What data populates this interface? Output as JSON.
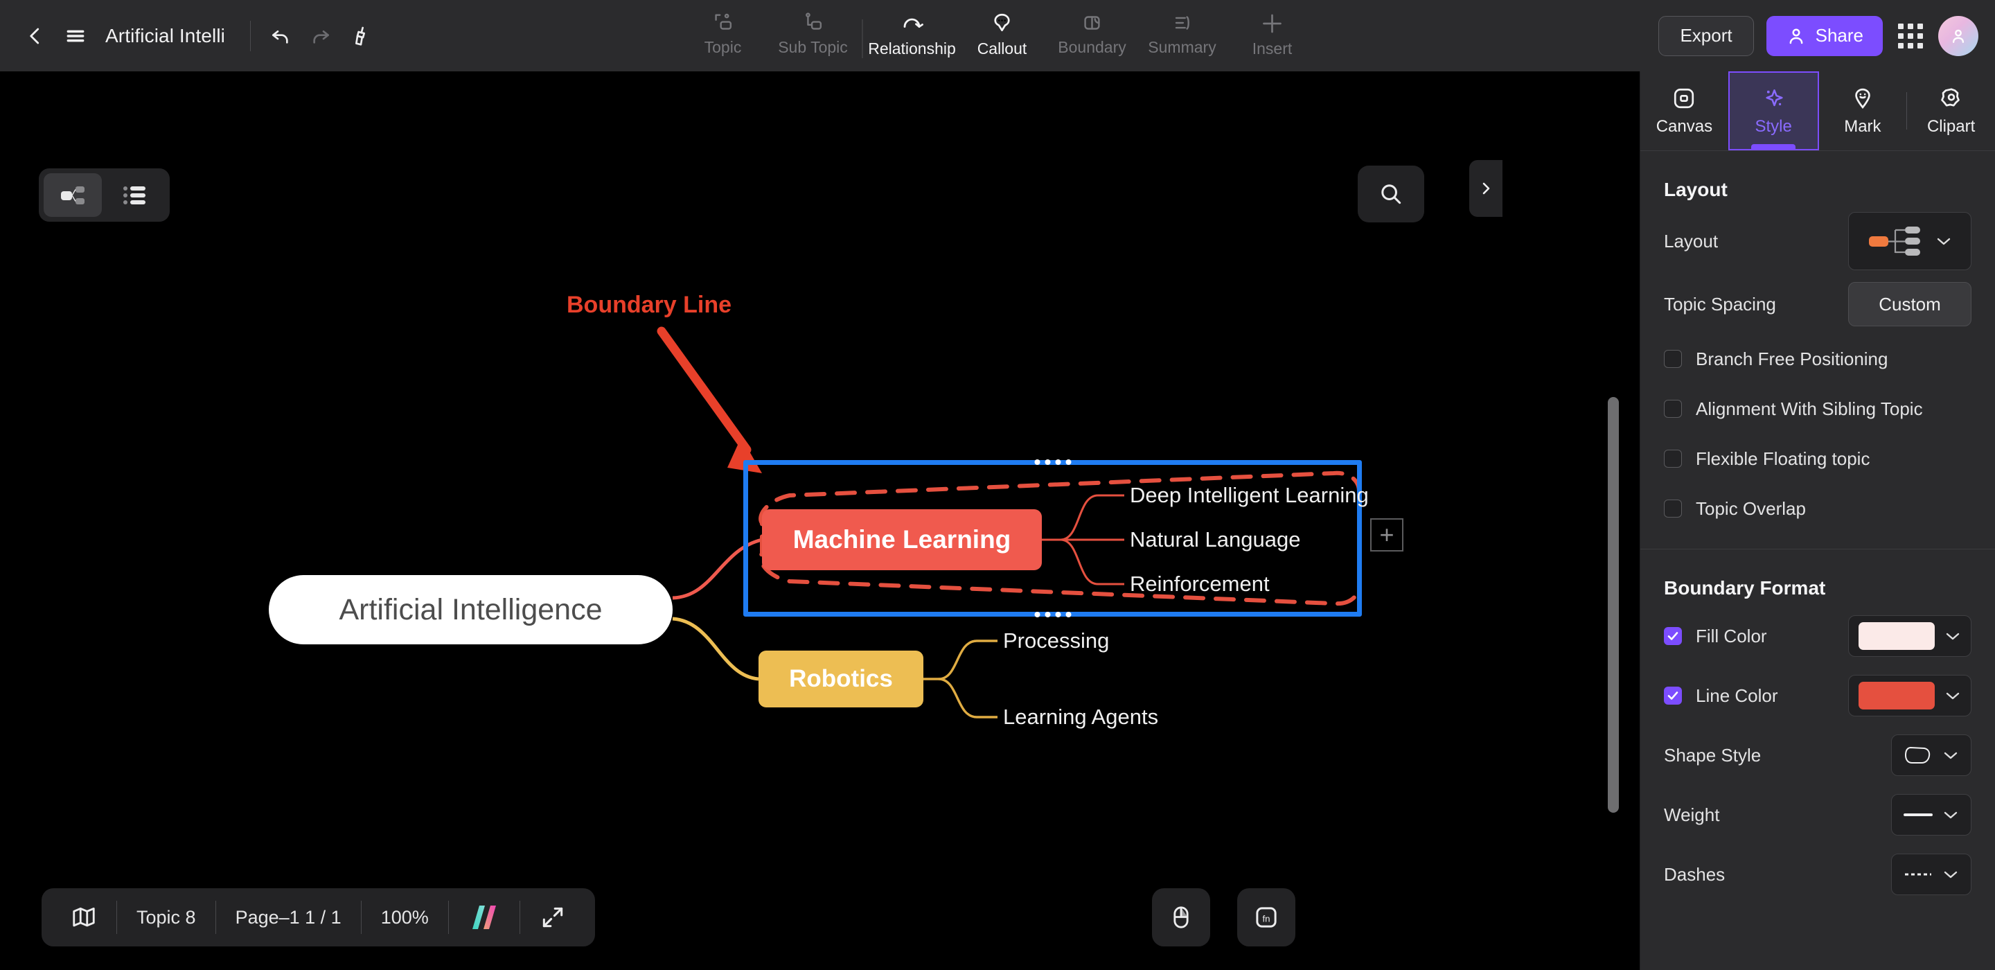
{
  "header": {
    "back_icon": "chevron-left-icon",
    "menu_icon": "hamburger-menu-icon",
    "doc_title": "Artificial Intelli",
    "undo_icon": "undo-icon",
    "redo_icon": "redo-icon",
    "format_painter_icon": "format-painter-icon",
    "tools": [
      {
        "label": "Topic",
        "icon": "topic-icon",
        "enabled": false
      },
      {
        "label": "Sub Topic",
        "icon": "sub-topic-icon",
        "enabled": false
      },
      {
        "label": "Relationship",
        "icon": "relationship-icon",
        "enabled": true
      },
      {
        "label": "Callout",
        "icon": "callout-icon",
        "enabled": true
      },
      {
        "label": "Boundary",
        "icon": "boundary-icon",
        "enabled": false
      },
      {
        "label": "Summary",
        "icon": "summary-icon",
        "enabled": false
      },
      {
        "label": "Insert",
        "icon": "insert-plus-icon",
        "enabled": false
      }
    ],
    "export_label": "Export",
    "share_label": "Share",
    "share_icon": "person-share-icon",
    "apps_icon": "apps-grid-icon",
    "avatar_icon": "user-avatar"
  },
  "canvas": {
    "view_toggle": {
      "mindmap_icon": "mindmap-view-icon",
      "outline_icon": "outline-view-icon",
      "selected": "mindmap"
    },
    "search_icon": "search-icon",
    "collapse_icon": "chevron-right-icon",
    "add_button_label": "+",
    "annotation": {
      "label": "Boundary Line",
      "color": "#e8402a",
      "arrow_icon": "annotation-arrow-icon"
    },
    "nodes": {
      "root": {
        "label": "Artificial Intelligence",
        "fill": "#ffffff",
        "text_color": "#4d4d4d"
      },
      "machine_learning": {
        "label": "Machine Learning",
        "fill": "#f05a4e",
        "text_color": "#ffffff",
        "children": [
          "Deep Intelligent Learning",
          "Natural Language",
          "Reinforcement"
        ]
      },
      "robotics": {
        "label": "Robotics",
        "fill": "#edbe53",
        "text_color": "#ffffff",
        "children": [
          "Processing",
          "Learning Agents"
        ]
      }
    },
    "boundary": {
      "selection_color": "#1f7cf2",
      "line_color": "#e5503f",
      "style": "dashed"
    }
  },
  "statusbar": {
    "map_icon": "map-icon",
    "topic_count": "Topic 8",
    "page": "Page–1  1 / 1",
    "zoom": "100%",
    "ai_icon": "ai-assistant-icon",
    "fullscreen_icon": "fullscreen-icon",
    "mouse_icon": "mouse-mode-icon",
    "fn_icon": "fn-key-icon"
  },
  "sidebar": {
    "tabs": [
      {
        "label": "Canvas",
        "icon": "canvas-icon",
        "selected": false
      },
      {
        "label": "Style",
        "icon": "style-sparkle-icon",
        "selected": true
      },
      {
        "label": "Mark",
        "icon": "mark-pin-icon",
        "selected": false
      },
      {
        "label": "Clipart",
        "icon": "clipart-icon",
        "selected": false
      }
    ],
    "layout_section": {
      "title": "Layout",
      "layout_label": "Layout",
      "layout_value_icon": "layout-right-tree-icon",
      "topic_spacing_label": "Topic Spacing",
      "topic_spacing_value": "Custom",
      "checkboxes": [
        {
          "label": "Branch Free Positioning",
          "checked": false
        },
        {
          "label": "Alignment With Sibling Topic",
          "checked": false
        },
        {
          "label": "Flexible Floating topic",
          "checked": false
        },
        {
          "label": "Topic Overlap",
          "checked": false
        }
      ]
    },
    "boundary_section": {
      "title": "Boundary Format",
      "fill_color_label": "Fill Color",
      "fill_color_checked": true,
      "fill_color_value": "#fbeae8",
      "line_color_label": "Line Color",
      "line_color_checked": true,
      "line_color_value": "#e5503f",
      "shape_style_label": "Shape Style",
      "shape_style_icon": "blob-shape-icon",
      "weight_label": "Weight",
      "weight_icon": "solid-line-icon",
      "dashes_label": "Dashes",
      "dashes_icon": "dashed-line-icon"
    }
  },
  "colors": {
    "accent_purple": "#7c4dff",
    "selection_blue": "#1f7cf2",
    "boundary_red": "#e5503f",
    "node_red": "#f05a4e",
    "node_yellow": "#edbe53",
    "annotation_red": "#e8402a"
  }
}
